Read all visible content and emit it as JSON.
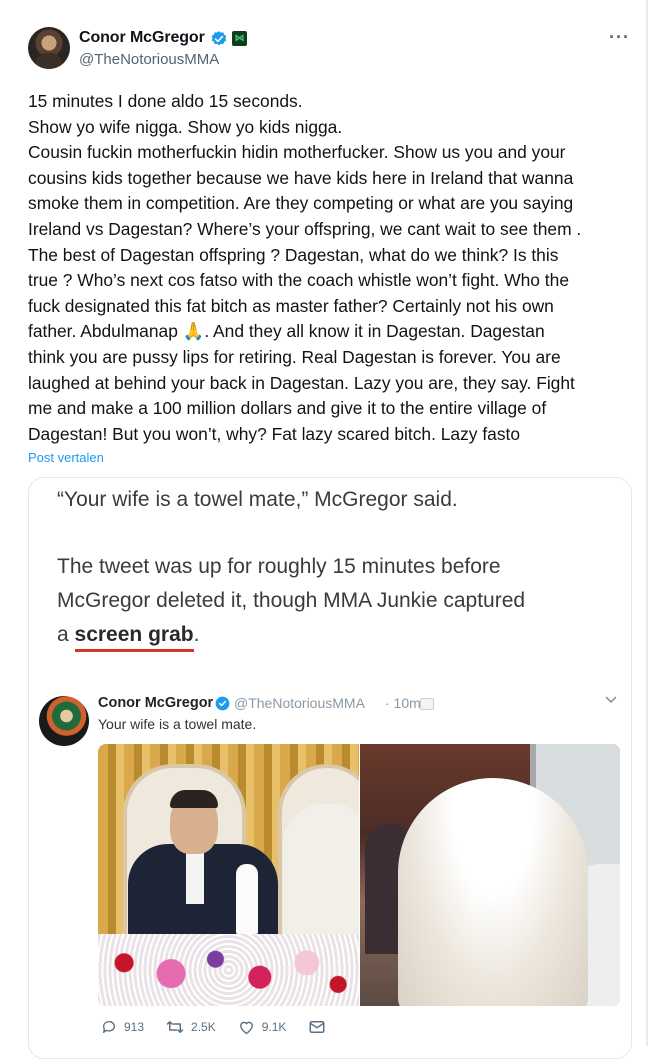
{
  "author": {
    "name": "Conor McGregor",
    "handle": "@TheNotoriousMMA",
    "affiliation_badge": "grid-badge-icon",
    "verified_color": "#1d9bf0"
  },
  "tweet": {
    "lines": [
      "15 minutes I done aldo 15 seconds.",
      "Show yo wife nigga. Show yo kids nigga.",
      "Cousin fuckin motherfuckin hidin motherfucker. Show us you and your",
      "cousins kids together because we have kids here in Ireland that wanna",
      "smoke them in competition. Are they competing or what are you saying",
      "Ireland vs Dagestan? Where’s your offspring, we cant wait to see them .",
      "The best of Dagestan offspring ? Dagestan, what do we think? Is this",
      "true ? Who’s next cos fatso with the coach whistle won’t fight. Who the",
      "fuck designated this fat bitch as master father? Certainly not his own",
      "father.  Abdulmanap 🙏. And they all know it in Dagestan. Dagestan",
      "think you are pussy lips for retiring. Real Dagestan is forever. You are",
      "laughed at behind your back in Dagestan. Lazy you are, they say. Fight",
      "me and make a 100 million dollars and give it to the entire village of",
      "Dagestan! But you won’t, why? Fat lazy scared bitch. Lazy fasto"
    ],
    "translate_label": "Post vertalen"
  },
  "media": {
    "article": {
      "quote": "“Your wife is a towel mate,” McGregor said.",
      "paragraph_line1": "The tweet was up for roughly 15 minutes before",
      "paragraph_line2": "McGregor deleted it, though MMA Junkie captured",
      "paragraph_line3_prefix": "a ",
      "link_text": "screen grab",
      "paragraph_line3_suffix": "."
    },
    "embedded_tweet": {
      "name": "Conor McGregor",
      "handle": "@TheNotoriousMMA",
      "time": "· 10m",
      "text": "Your wife is a towel mate.",
      "reply_count": "913",
      "retweet_count": "2.5K",
      "like_count": "9.1K"
    }
  }
}
